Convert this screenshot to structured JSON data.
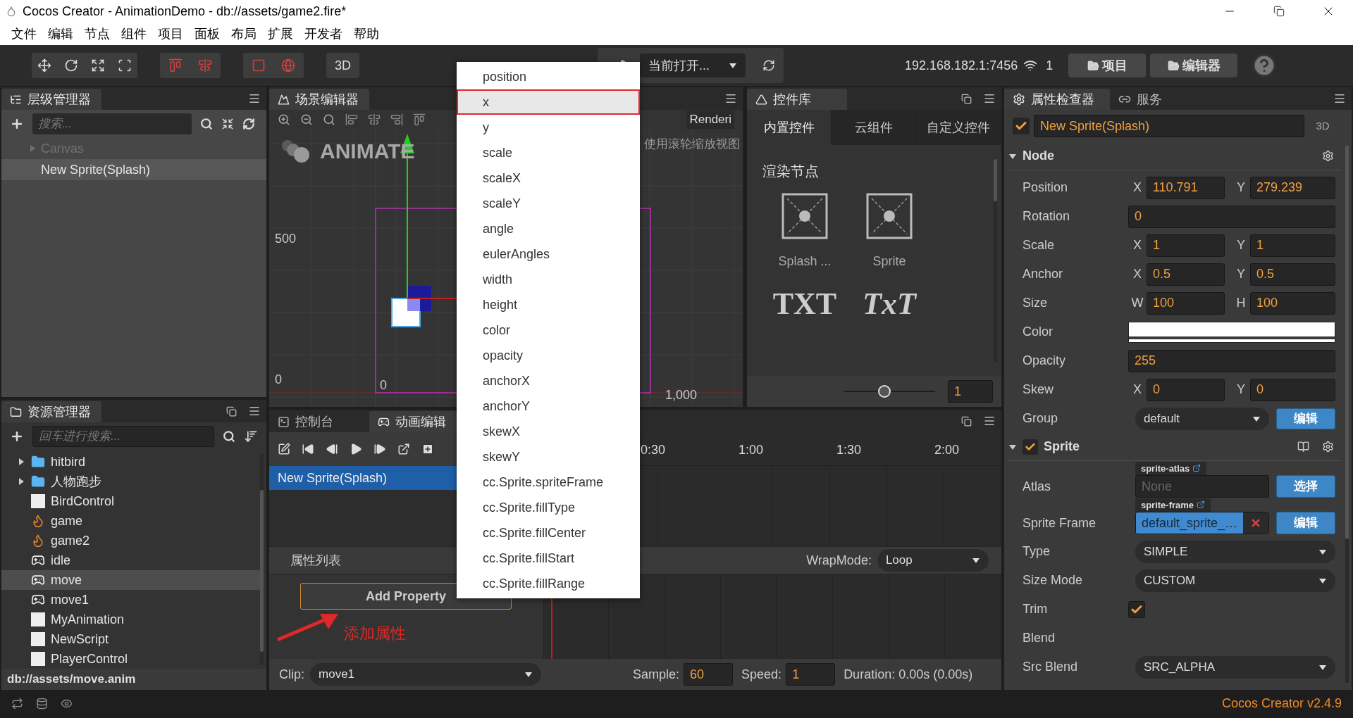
{
  "window": {
    "title": "Cocos Creator - AnimationDemo - db://assets/game2.fire*"
  },
  "menu_bar": [
    "文件",
    "编辑",
    "节点",
    "组件",
    "项目",
    "面板",
    "布局",
    "扩展",
    "开发者",
    "帮助"
  ],
  "toolbar": {
    "view_mode": "3D",
    "scene_select": "当前打开...",
    "address": "192.168.182.1:7456",
    "device_count": "1",
    "buttons": [
      "项目",
      "编辑器"
    ]
  },
  "hierarchy": {
    "title": "层级管理器",
    "search_placeholder": "搜索...",
    "nodes": [
      {
        "label": "Canvas",
        "kind": "parent",
        "disabled": true,
        "selected": false
      },
      {
        "label": "New Sprite(Splash)",
        "kind": "leaf",
        "disabled": false,
        "selected": true
      }
    ]
  },
  "scene": {
    "title": "场景编辑器",
    "render_menu": "Renderi",
    "logo": "ANIMATE",
    "hint": "使用滚轮缩放视图",
    "axis_labels": {
      "y_high": "500",
      "y_zero": "0",
      "x_zero": "0",
      "x_high": "1,000"
    }
  },
  "library": {
    "title": "控件库",
    "tabs": [
      {
        "label": "内置控件",
        "selected": true
      },
      {
        "label": "云组件",
        "selected": false
      },
      {
        "label": "自定义控件",
        "selected": false
      }
    ],
    "section": "渲染节点",
    "items": [
      {
        "kind": "sprite",
        "label": "Splash ..."
      },
      {
        "kind": "sprite",
        "label": "Sprite"
      },
      {
        "kind": "label",
        "glyph": "TXT"
      },
      {
        "kind": "richtext",
        "glyph": "TxT"
      }
    ],
    "zoom": {
      "level": 0.45,
      "value": "1"
    }
  },
  "inspector": {
    "tabs": [
      {
        "label": "属性检查器",
        "selected": true
      },
      {
        "label": "服务",
        "selected": false
      }
    ],
    "node_active": true,
    "node_name": "New Sprite(Splash)",
    "mode": "3D",
    "components": [
      {
        "kind": "node",
        "title": "Node",
        "expanded": true,
        "properties": [
          {
            "label": "Position",
            "kind": "vec2",
            "fields": [
              {
                "axis": "X",
                "value": "110.791"
              },
              {
                "axis": "Y",
                "value": "279.239"
              }
            ]
          },
          {
            "label": "Rotation",
            "kind": "number",
            "value": "0"
          },
          {
            "label": "Scale",
            "kind": "vec2",
            "fields": [
              {
                "axis": "X",
                "value": "1"
              },
              {
                "axis": "Y",
                "value": "1"
              }
            ]
          },
          {
            "label": "Anchor",
            "kind": "vec2",
            "fields": [
              {
                "axis": "X",
                "value": "0.5"
              },
              {
                "axis": "Y",
                "value": "0.5"
              }
            ]
          },
          {
            "label": "Size",
            "kind": "vec2",
            "fields": [
              {
                "axis": "W",
                "value": "100"
              },
              {
                "axis": "H",
                "value": "100"
              }
            ]
          },
          {
            "label": "Color",
            "kind": "color",
            "color": "#ffffff"
          },
          {
            "label": "Opacity",
            "kind": "number",
            "value": "255"
          },
          {
            "label": "Skew",
            "kind": "vec2",
            "fields": [
              {
                "axis": "X",
                "value": "0"
              },
              {
                "axis": "Y",
                "value": "0"
              }
            ]
          },
          {
            "label": "Group",
            "kind": "select",
            "value": "default",
            "button": "编辑"
          }
        ]
      },
      {
        "kind": "component",
        "title": "Sprite",
        "expanded": true,
        "enabled": true,
        "properties": [
          {
            "label": "Atlas",
            "kind": "asset",
            "tag": "sprite-atlas",
            "placeholder": "None",
            "button": "选择"
          },
          {
            "label": "Sprite Frame",
            "kind": "asset",
            "tag": "sprite-frame",
            "value": "default_sprite_…",
            "button": "编辑"
          },
          {
            "label": "Type",
            "kind": "select",
            "value": "SIMPLE"
          },
          {
            "label": "Size Mode",
            "kind": "select",
            "value": "CUSTOM"
          },
          {
            "label": "Trim",
            "kind": "checkbox",
            "checked": true
          },
          {
            "label": "Blend",
            "kind": "heading"
          },
          {
            "label": "Src Blend",
            "kind": "select",
            "value": "SRC_ALPHA"
          }
        ]
      }
    ]
  },
  "assets": {
    "title": "资源管理器",
    "search_placeholder": "回车进行搜索...",
    "items": [
      {
        "label": "hitbird",
        "kind": "folder",
        "expanded": false,
        "selected": false
      },
      {
        "label": "人物跑步",
        "kind": "folder",
        "expanded": false,
        "selected": false
      },
      {
        "label": "BirdControl",
        "kind": "script",
        "selected": false
      },
      {
        "label": "game",
        "kind": "scene",
        "selected": false
      },
      {
        "label": "game2",
        "kind": "scene",
        "selected": false
      },
      {
        "label": "idle",
        "kind": "animation",
        "selected": false
      },
      {
        "label": "move",
        "kind": "animation",
        "selected": true
      },
      {
        "label": "move1",
        "kind": "animation",
        "selected": false
      },
      {
        "label": "MyAnimation",
        "kind": "script",
        "selected": false
      },
      {
        "label": "NewScript",
        "kind": "script",
        "selected": false
      },
      {
        "label": "PlayerControl",
        "kind": "script",
        "selected": false
      }
    ],
    "path": "db://assets/move.anim"
  },
  "bottom_tabs": [
    {
      "label": "控制台",
      "kind": "console",
      "selected": false
    },
    {
      "label": "动画编辑",
      "kind": "animation",
      "selected": true
    }
  ],
  "animation": {
    "nodes": [
      {
        "label": "New Sprite(Splash)",
        "selected": true
      }
    ],
    "property_list_title": "属性列表",
    "add_property": "Add Property",
    "annotation": "添加属性",
    "ruler": [
      "0:30",
      "1:00",
      "1:30",
      "2:00"
    ],
    "wrap_mode_label": "WrapMode:",
    "wrap_mode": "Loop",
    "clip_label": "Clip:",
    "clip": "move1",
    "sample_label": "Sample:",
    "sample": "60",
    "speed_label": "Speed:",
    "speed": "1",
    "duration": "Duration: 0.00s (0.00s)"
  },
  "property_menu": {
    "items": [
      {
        "label": "position",
        "selected": false
      },
      {
        "label": "x",
        "selected": true
      },
      {
        "label": "y",
        "selected": false
      },
      {
        "label": "scale",
        "selected": false
      },
      {
        "label": "scaleX",
        "selected": false
      },
      {
        "label": "scaleY",
        "selected": false
      },
      {
        "label": "angle",
        "selected": false
      },
      {
        "label": "eulerAngles",
        "selected": false
      },
      {
        "label": "width",
        "selected": false
      },
      {
        "label": "height",
        "selected": false
      },
      {
        "label": "color",
        "selected": false
      },
      {
        "label": "opacity",
        "selected": false
      },
      {
        "label": "anchorX",
        "selected": false
      },
      {
        "label": "anchorY",
        "selected": false
      },
      {
        "label": "skewX",
        "selected": false
      },
      {
        "label": "skewY",
        "selected": false
      },
      {
        "label": "cc.Sprite.spriteFrame",
        "selected": false
      },
      {
        "label": "cc.Sprite.fillType",
        "selected": false
      },
      {
        "label": "cc.Sprite.fillCenter",
        "selected": false
      },
      {
        "label": "cc.Sprite.fillStart",
        "selected": false
      },
      {
        "label": "cc.Sprite.fillRange",
        "selected": false
      }
    ]
  },
  "status_bar": {
    "version": "Cocos Creator v2.4.9"
  }
}
